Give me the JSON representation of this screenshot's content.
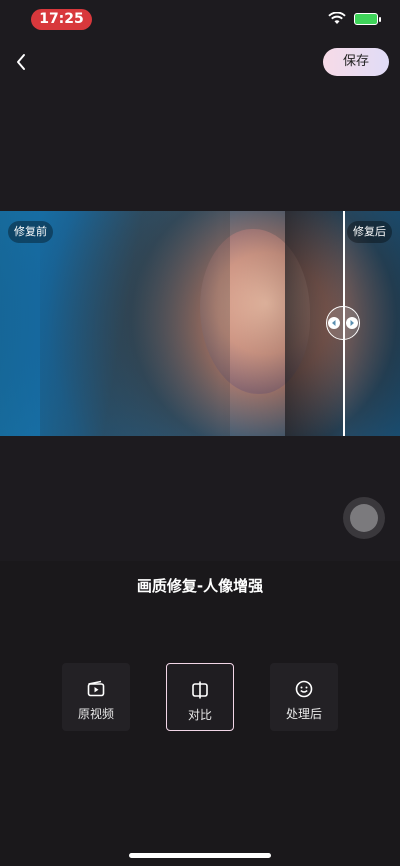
{
  "status_bar": {
    "time": "17:25"
  },
  "header": {
    "save_label": "保存"
  },
  "preview": {
    "before_label": "修复前",
    "after_label": "修复后"
  },
  "panel": {
    "title": "画质修复-人像增强",
    "options": [
      {
        "label": "原视频",
        "icon": "video-clip-icon",
        "selected": false
      },
      {
        "label": "对比",
        "icon": "compare-icon",
        "selected": true
      },
      {
        "label": "处理后",
        "icon": "smile-face-icon",
        "selected": false
      }
    ]
  }
}
